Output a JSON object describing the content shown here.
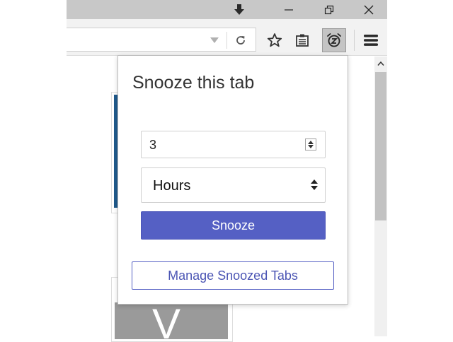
{
  "colors": {
    "accent": "#5560c4",
    "accent_text": "#4b55b4",
    "chrome": "#c8c8c8",
    "toolbar": "#f2f2f2",
    "card_bar": "#1f5a8c"
  },
  "window_controls": {
    "download_icon": "download-arrow-icon",
    "minimize_icon": "minimize-icon",
    "restore_icon": "restore-icon",
    "close_icon": "close-icon"
  },
  "toolbar": {
    "icons": [
      "dropdown-arrow-icon",
      "reload-icon",
      "star-icon",
      "reading-list-icon",
      "snooze-alarm-icon",
      "menu-icon"
    ]
  },
  "background_card": {
    "letter": "V"
  },
  "popup": {
    "title": "Snooze this tab",
    "amount_value": "3",
    "unit_selected": "Hours",
    "snooze_label": "Snooze",
    "manage_label": "Manage Snoozed Tabs"
  }
}
